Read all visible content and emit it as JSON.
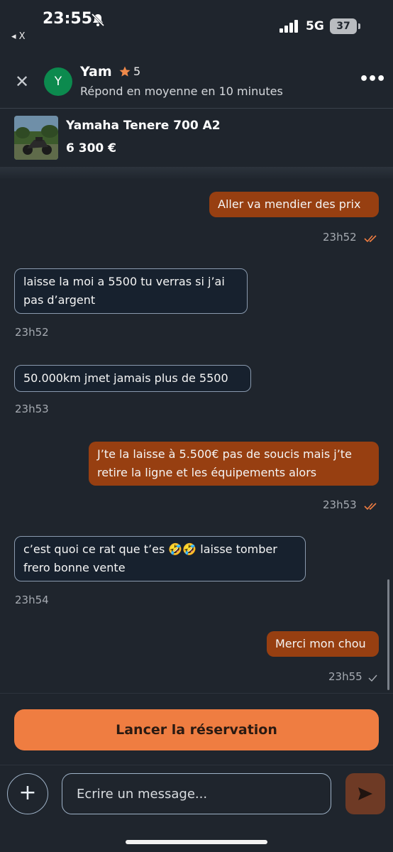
{
  "status_bar": {
    "time": "23:55",
    "back_app": "◂ X",
    "network": "5G",
    "battery": "37"
  },
  "header": {
    "close_label": "✕",
    "avatar_letter": "Y",
    "name": "Yam",
    "rating": "5",
    "subtitle": "Répond en moyenne en 10 minutes",
    "more_label": "•••"
  },
  "listing": {
    "title": "Yamaha Tenere 700 A2",
    "price": "6 300 €"
  },
  "messages": [
    {
      "direction": "out",
      "text": "Aller va mendier des prix",
      "time": "23h52",
      "status": "read"
    },
    {
      "direction": "in",
      "text": "laisse la moi a 5500 tu verras si j’ai pas d’argent",
      "time": "23h52"
    },
    {
      "direction": "in",
      "text": "50.000km jmet jamais plus de 5500",
      "time": "23h53"
    },
    {
      "direction": "out",
      "text": "J’te la laisse à 5.500€ pas de soucis mais j’te retire la ligne et les équipements alors",
      "time": "23h53",
      "status": "read"
    },
    {
      "direction": "in",
      "text": "c’est quoi ce rat que t’es 🤣🤣 laisse tomber frero bonne vente",
      "time": "23h54"
    },
    {
      "direction": "out",
      "text": "Merci mon chou",
      "time": "23h55",
      "status": "sent"
    }
  ],
  "actions": {
    "reserve_label": "Lancer la réservation",
    "add_label": "+"
  },
  "compose": {
    "placeholder": "Ecrire un message..."
  },
  "colors": {
    "outgoing_bubble": "#973f11",
    "incoming_bubble": "#17212e",
    "accent": "#ef7d41",
    "background": "#1f252d"
  }
}
